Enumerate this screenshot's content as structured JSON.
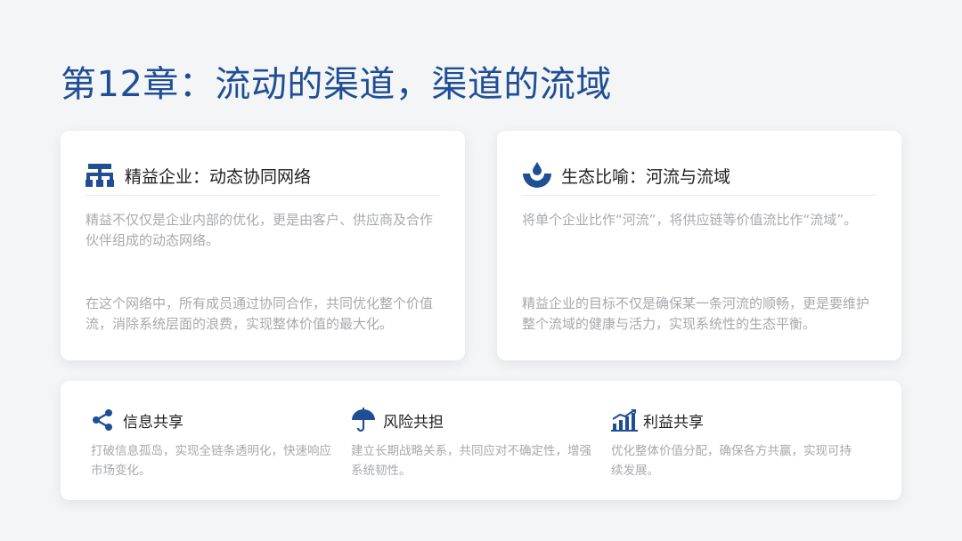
{
  "title": "第12章：流动的渠道，渠道的流域",
  "colors": {
    "accent": "#1f4e94",
    "background": "#f4f5f7",
    "card": "#ffffff",
    "muted_text": "#a7a9ad"
  },
  "cards": [
    {
      "icon": "org-chart-icon",
      "title": "精益企业：动态协同网络",
      "paragraphs": [
        "精益不仅仅是企业内部的优化，更是由客户、供应商及合作伙伴组成的动态网络。",
        "在这个网络中，所有成员通过协同合作，共同优化整个价值流，消除系统层面的浪费，实现整体价值的最大化。"
      ]
    },
    {
      "icon": "water-drop-icon",
      "title": "生态比喻：河流与流域",
      "paragraphs": [
        "将单个企业比作“河流”，将供应链等价值流比作“流域”。",
        "精益企业的目标不仅是确保某一条河流的顺畅，更是要维护整个流域的健康与活力，实现系统性的生态平衡。"
      ]
    }
  ],
  "features": [
    {
      "icon": "share-icon",
      "title": "信息共享",
      "desc": "打破信息孤岛，实现全链条透明化，快速响应市场变化。"
    },
    {
      "icon": "umbrella-icon",
      "title": "风险共担",
      "desc": "建立长期战略关系，共同应对不确定性，增强系统韧性。"
    },
    {
      "icon": "bar-chart-icon",
      "title": "利益共享",
      "desc": "优化整体价值分配，确保各方共赢，实现可持续发展。"
    }
  ]
}
